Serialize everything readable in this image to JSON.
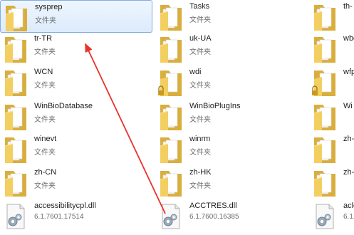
{
  "items": [
    {
      "name": "sysprep",
      "type": "文件夹",
      "icon": "folder-icon"
    },
    {
      "name": "tr-TR",
      "type": "文件夹",
      "icon": "folder-icon"
    },
    {
      "name": "WCN",
      "type": "文件夹",
      "icon": "folder-icon"
    },
    {
      "name": "WinBioDatabase",
      "type": "文件夹",
      "icon": "folder-icon"
    },
    {
      "name": "winevt",
      "type": "文件夹",
      "icon": "folder-icon"
    },
    {
      "name": "zh-CN",
      "type": "文件夹",
      "icon": "folder-icon"
    },
    {
      "name": "accessibilitycpl.dll",
      "type": "6.1.7601.17514",
      "icon": "dll-file-icon"
    },
    {
      "name": "Tasks",
      "type": "文件夹",
      "icon": "folder-icon"
    },
    {
      "name": "uk-UA",
      "type": "文件夹",
      "icon": "folder-icon"
    },
    {
      "name": "wdi",
      "type": "文件夹",
      "icon": "locked-folder-icon"
    },
    {
      "name": "WinBioPlugIns",
      "type": "文件夹",
      "icon": "folder-icon"
    },
    {
      "name": "winrm",
      "type": "文件夹",
      "icon": "folder-icon"
    },
    {
      "name": "zh-HK",
      "type": "文件夹",
      "icon": "folder-icon"
    },
    {
      "name": "ACCTRES.dll",
      "type": "6.1.7600.16385",
      "icon": "dll-file-icon"
    },
    {
      "name": "th-",
      "type": "",
      "icon": "folder-icon"
    },
    {
      "name": "wbe",
      "type": "",
      "icon": "folder-icon"
    },
    {
      "name": "wfp",
      "type": "",
      "icon": "locked-folder-icon"
    },
    {
      "name": "Wi",
      "type": "",
      "icon": "folder-icon"
    },
    {
      "name": "zh-",
      "type": "",
      "icon": "folder-icon"
    },
    {
      "name": "zh-",
      "type": "",
      "icon": "folder-icon"
    },
    {
      "name": "acle",
      "type": "6.1.",
      "icon": "dll-file-icon"
    }
  ],
  "selected_item": "sysprep",
  "colors": {
    "selection": "#dcebfc",
    "selection_border": "#84acdd",
    "annotation_arrow": "#e8322b",
    "folder": "#f3cf62"
  }
}
